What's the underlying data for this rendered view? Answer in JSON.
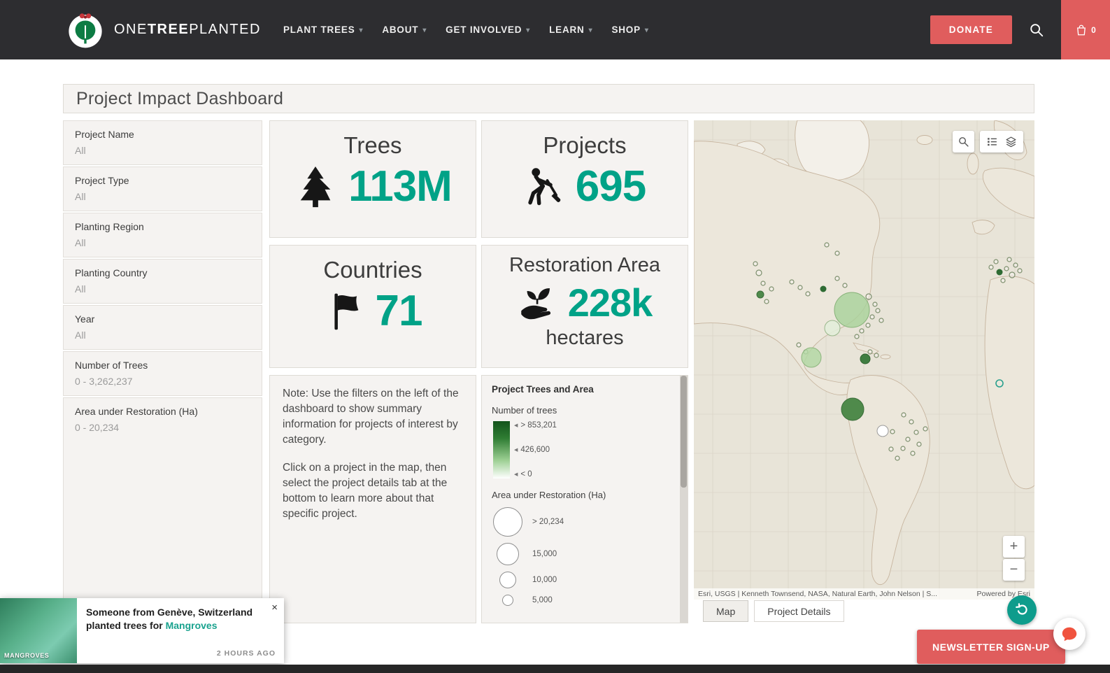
{
  "nav": {
    "brand_parts": {
      "one": "ONE",
      "tree": "TREE",
      "planted": "PLANTED"
    },
    "items": [
      {
        "label": "PLANT TREES"
      },
      {
        "label": "ABOUT"
      },
      {
        "label": "GET INVOLVED"
      },
      {
        "label": "LEARN"
      },
      {
        "label": "SHOP"
      }
    ],
    "donate_label": "DONATE",
    "cart_count": "0"
  },
  "page": {
    "title": "Project Impact Dashboard"
  },
  "filters": [
    {
      "label": "Project Name",
      "value": "All"
    },
    {
      "label": "Project Type",
      "value": "All"
    },
    {
      "label": "Planting Region",
      "value": "All"
    },
    {
      "label": "Planting Country",
      "value": "All"
    },
    {
      "label": "Year",
      "value": "All"
    },
    {
      "label": "Number of Trees",
      "value": "0 - 3,262,237"
    },
    {
      "label": "Area under Restoration (Ha)",
      "value": "0 - 20,234"
    }
  ],
  "stats": {
    "trees": {
      "title": "Trees",
      "value": "113M"
    },
    "projects": {
      "title": "Projects",
      "value": "695"
    },
    "countries": {
      "title": "Countries",
      "value": "71"
    },
    "restoration": {
      "title": "Restoration Area",
      "value": "228k",
      "unit": "hectares"
    }
  },
  "note": {
    "p1": "Note: Use the filters on the left of the dashboard to show summary information for projects of interest by category.",
    "p2": "Click on a project in the map, then select the project details tab at the bottom to learn more about that specific project."
  },
  "legend": {
    "title": "Project Trees and Area",
    "trees_label": "Number of trees",
    "trees_ticks": [
      "> 853,201",
      "426,600",
      "< 0"
    ],
    "area_label": "Area under Restoration (Ha)",
    "area_ticks": [
      "> 20,234",
      "15,000",
      "10,000",
      "5,000"
    ]
  },
  "map": {
    "attribution": "Esri, USGS | Kenneth Townsend, NASA, Natural Earth, John Nelson | S...",
    "powered_by": "Powered by Esri",
    "zoom_in": "+",
    "zoom_out": "−",
    "tabs": [
      {
        "label": "Map"
      },
      {
        "label": "Project Details"
      }
    ]
  },
  "notification": {
    "image_label": "MANGROVES",
    "message_prefix": "Someone from Genève, Switzerland planted trees for ",
    "link_text": "Mangroves",
    "time": "2 HOURS AGO",
    "close": "×"
  },
  "newsletter_label": "NEWSLETTER SIGN-UP",
  "colors": {
    "accent_teal": "#00a287",
    "brand_red": "#e05d5d",
    "nav_bg": "#2d2d30"
  }
}
